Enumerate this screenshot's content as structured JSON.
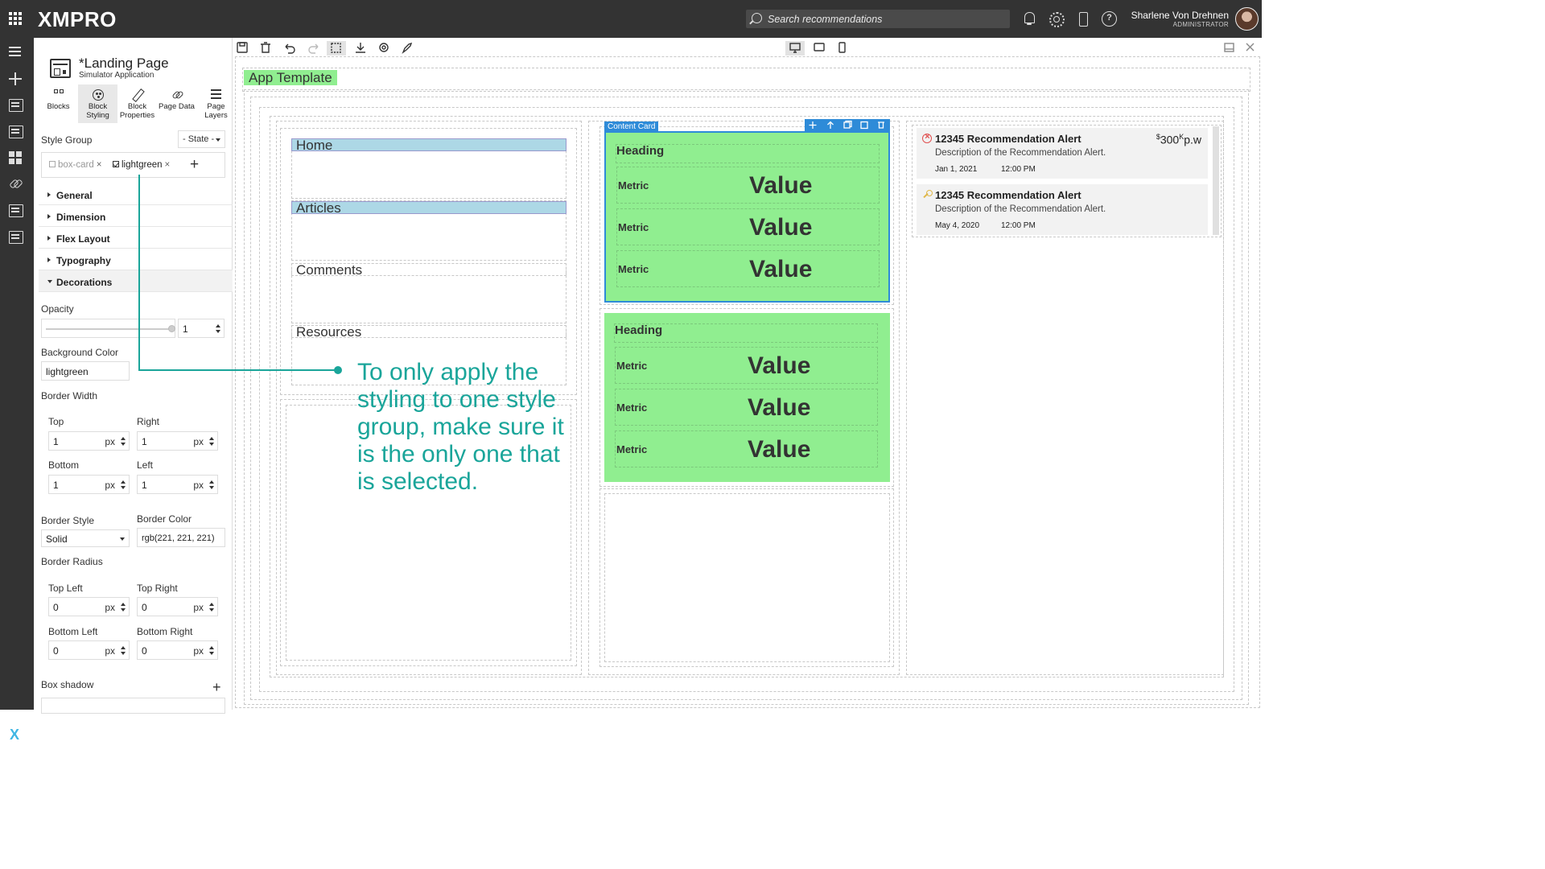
{
  "header": {
    "logo": "XMPRO",
    "search_placeholder": "Search recommendations",
    "user_name": "Sharlene Von Drehnen",
    "user_role": "ADMINISTRATOR"
  },
  "panel": {
    "title": "*Landing Page",
    "subtitle": "Simulator Application",
    "tabs": [
      {
        "label": "Blocks",
        "icon": "blocks-icon"
      },
      {
        "label": "Block Styling",
        "icon": "palette-icon"
      },
      {
        "label": "Block Properties",
        "icon": "pencil-icon"
      },
      {
        "label": "Page Data",
        "icon": "link-icon"
      },
      {
        "label": "Page Layers",
        "icon": "layers-icon"
      }
    ],
    "style_group_label": "Style Group",
    "state_button": "- State -",
    "style_tags": [
      {
        "label": "box-card",
        "selected": false
      },
      {
        "label": "lightgreen",
        "selected": true
      }
    ],
    "sections": {
      "general": "General",
      "dimension": "Dimension",
      "flex_layout": "Flex Layout",
      "typography": "Typography",
      "decorations": "Decorations"
    },
    "opacity": {
      "label": "Opacity",
      "value": "1",
      "slider_fraction": 1.0
    },
    "background_color": {
      "label": "Background Color",
      "value": "lightgreen"
    },
    "border_width": {
      "label": "Border Width",
      "top_label": "Top",
      "top_value": "1",
      "right_label": "Right",
      "right_value": "1",
      "bottom_label": "Bottom",
      "bottom_value": "1",
      "left_label": "Left",
      "left_value": "1",
      "unit": "px"
    },
    "border_style": {
      "label": "Border Style",
      "value": "Solid"
    },
    "border_color": {
      "label": "Border Color",
      "value": "rgb(221, 221, 221)"
    },
    "border_radius": {
      "label": "Border Radius",
      "top_left_label": "Top Left",
      "top_left_value": "0",
      "top_right_label": "Top Right",
      "top_right_value": "0",
      "bottom_left_label": "Bottom Left",
      "bottom_left_value": "0",
      "bottom_right_label": "Bottom Right",
      "bottom_right_value": "0",
      "unit": "px"
    },
    "box_shadow_label": "Box shadow"
  },
  "canvas": {
    "app_template": "App Template",
    "nav": [
      "Home",
      "Articles",
      "Comments",
      "Resources"
    ],
    "content_card_label": "Content Card",
    "cards": [
      {
        "heading": "Heading",
        "rows": [
          {
            "metric": "Metric",
            "value": "Value"
          },
          {
            "metric": "Metric",
            "value": "Value"
          },
          {
            "metric": "Metric",
            "value": "Value"
          }
        ]
      },
      {
        "heading": "Heading",
        "rows": [
          {
            "metric": "Metric",
            "value": "Value"
          },
          {
            "metric": "Metric",
            "value": "Value"
          },
          {
            "metric": "Metric",
            "value": "Value"
          }
        ]
      }
    ],
    "recommendations": [
      {
        "title": "12345 Recommendation Alert",
        "description": "Description of the Recommendation Alert.",
        "date": "Jan 1, 2021",
        "time": "12:00 PM",
        "price_prefix": "$",
        "price_value": "300",
        "price_k": "K",
        "price_suffix": "p.w",
        "icon": "error-circle-icon"
      },
      {
        "title": "12345 Recommendation Alert",
        "description": "Description of the Recommendation Alert.",
        "date": "May 4, 2020",
        "time": "12:00 PM",
        "icon": "key-icon"
      }
    ]
  },
  "callout": "To only apply the styling to one style group, make sure it is the only one that is selected.",
  "colors": {
    "topbar": "#333333",
    "lightgreen": "#90ee90",
    "lightblue": "#add8e6",
    "selection_blue": "#2e8bd8",
    "callout_teal": "#1aa59a"
  }
}
